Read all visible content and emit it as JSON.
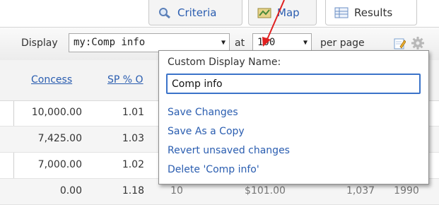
{
  "tabs": [
    {
      "label": "Criteria",
      "icon": "magnifier-icon"
    },
    {
      "label": "Map",
      "icon": "map-icon"
    },
    {
      "label": "Results",
      "icon": "grid-icon"
    }
  ],
  "toolbar": {
    "display_label": "Display",
    "display_value": "my:Comp info",
    "at_label": "at",
    "per_page_value": "100",
    "per_page_label": "per page"
  },
  "table": {
    "headers": [
      "Concess",
      "SP % O"
    ],
    "rows": [
      [
        "10,000.00",
        "1.01",
        "",
        "",
        "",
        ""
      ],
      [
        "7,425.00",
        "1.03",
        "",
        "",
        "",
        ""
      ],
      [
        "7,000.00",
        "1.02",
        "",
        "",
        "",
        ""
      ],
      [
        "0.00",
        "1.18",
        "10",
        "$101.00",
        "1,037",
        "1990"
      ]
    ]
  },
  "popup": {
    "title": "Custom Display Name:",
    "input_value": "Comp info",
    "actions": [
      "Save Changes",
      "Save As a Copy",
      "Revert unsaved changes",
      "Delete 'Comp info'"
    ]
  },
  "colors": {
    "link": "#2a5db0",
    "input_border": "#3b73c9",
    "arrow": "#e02020"
  }
}
